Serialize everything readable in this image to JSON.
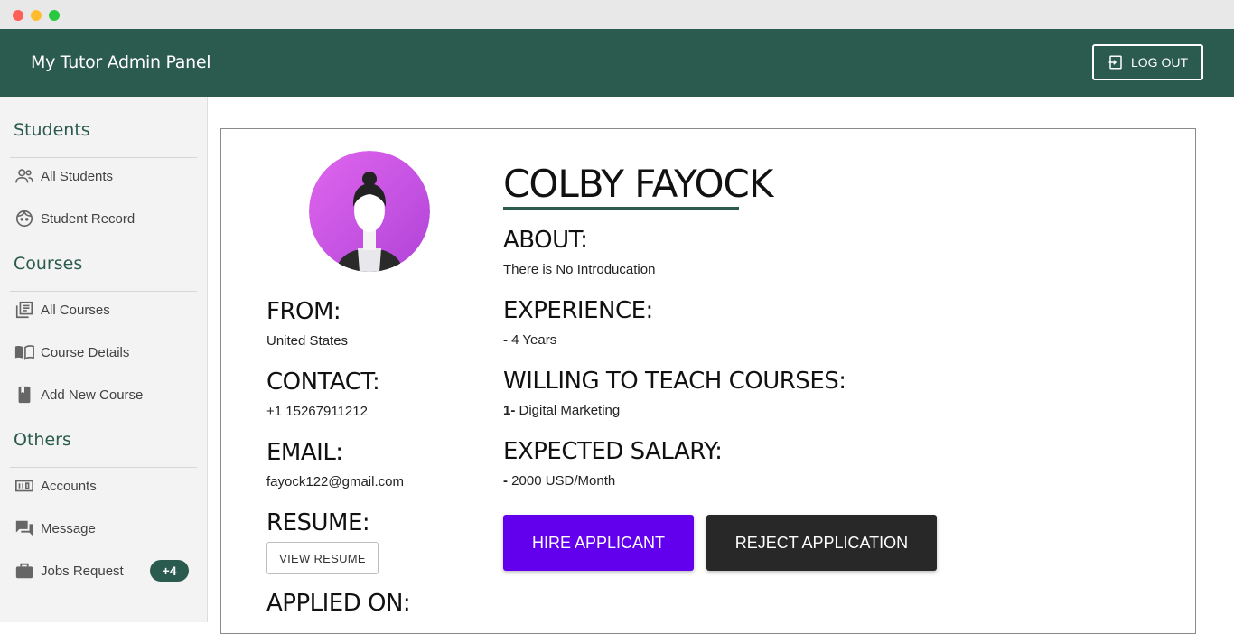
{
  "app": {
    "title": "My Tutor Admin Panel",
    "logout_label": "LOG OUT"
  },
  "sidebar": {
    "sections": [
      {
        "title": "Students",
        "items": [
          {
            "label": "All Students",
            "icon": "people-icon"
          },
          {
            "label": "Student Record",
            "icon": "face-icon"
          }
        ]
      },
      {
        "title": "Courses",
        "items": [
          {
            "label": "All Courses",
            "icon": "library-books-icon"
          },
          {
            "label": "Course Details",
            "icon": "open-book-icon"
          },
          {
            "label": "Add New Course",
            "icon": "book-icon"
          }
        ]
      },
      {
        "title": "Others",
        "items": [
          {
            "label": "Accounts",
            "icon": "counter-icon"
          },
          {
            "label": "Message",
            "icon": "forum-icon"
          },
          {
            "label": "Jobs Request",
            "icon": "briefcase-icon",
            "badge": "+4"
          }
        ]
      }
    ]
  },
  "profile": {
    "name": "COLBY FAYOCK",
    "from_label": "FROM:",
    "from_value": "United States",
    "contact_label": "CONTACT:",
    "contact_value": "+1 15267911212",
    "email_label": "EMAIL:",
    "email_value": "fayock122@gmail.com",
    "resume_label": "RESUME:",
    "view_resume": "VIEW RESUME",
    "applied_on_label": "APPLIED ON:",
    "about_label": "ABOUT:",
    "about_value": "There is No Introducation",
    "experience_label": "EXPERIENCE:",
    "experience_prefix": "-",
    "experience_value": "4 Years",
    "courses_label": "WILLING TO TEACH COURSES:",
    "courses_prefix": "1-",
    "courses_value": "Digital Marketing",
    "salary_label": "EXPECTED SALARY:",
    "salary_prefix": "-",
    "salary_value": "2000 USD/Month",
    "hire_label": "HIRE APPLICANT",
    "reject_label": "REJECT APPLICATION"
  },
  "colors": {
    "brand": "#2b5a4e",
    "hire": "#6200ee",
    "reject": "#282828",
    "avatar_bg": "#d65ce8"
  }
}
